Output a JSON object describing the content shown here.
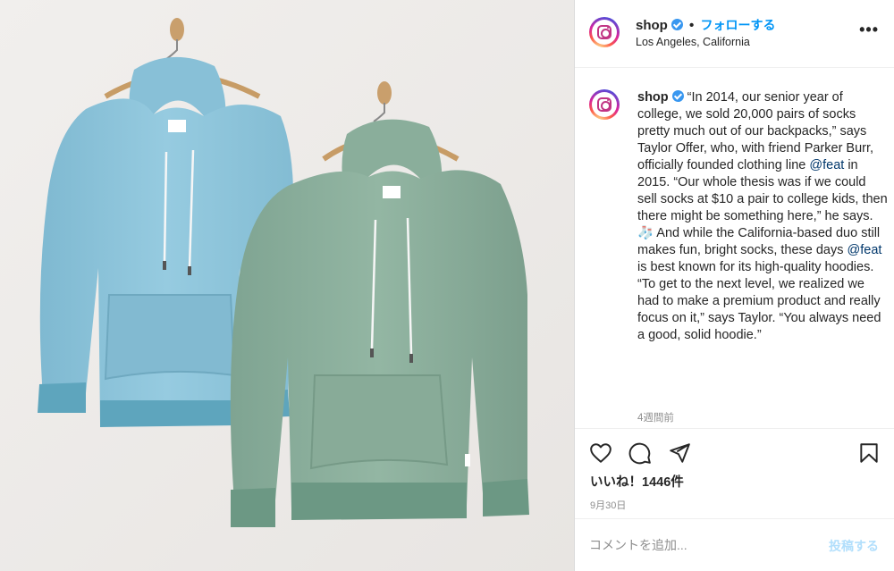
{
  "post": {
    "username": "shop",
    "verified": true,
    "follow_label": "フォローする",
    "separator": "•",
    "location": "Los Angeles, California",
    "more_label": "•••"
  },
  "caption": {
    "username": "shop",
    "text_1": "“In 2014, our senior year of college, we sold 20,000 pairs of socks pretty much out of our backpacks,” says Taylor Offer, who, with friend Parker Burr, officially founded clothing line ",
    "mention_1": "@feat",
    "text_2": " in 2015. “Our whole thesis was if we could sell socks at $10 a pair to college kids, then there might be something here,” he says. ",
    "emoji": "🧦",
    "text_3": " And while the California-based duo still makes fun, bright socks, these days ",
    "mention_2": "@feat",
    "text_4": " is best known for its high-quality hoodies. “To get to the next level, we realized we had to make a premium product and really focus on it,” says Taylor. “You always need a good, solid hoodie.”",
    "time_ago": "4週間前"
  },
  "actions": {
    "like_icon": "heart-icon",
    "comment_icon": "comment-icon",
    "share_icon": "paper-plane-icon",
    "save_icon": "bookmark-icon",
    "likes_text": "いいね！1446件",
    "date": "9月30日"
  },
  "comment": {
    "placeholder": "コメントを追加...",
    "post_label": "投稿する"
  },
  "image": {
    "description_colors": {
      "background": "#efedeb",
      "blue_hoodie": "#8ec6dc",
      "green_hoodie": "#8fb29f"
    }
  }
}
